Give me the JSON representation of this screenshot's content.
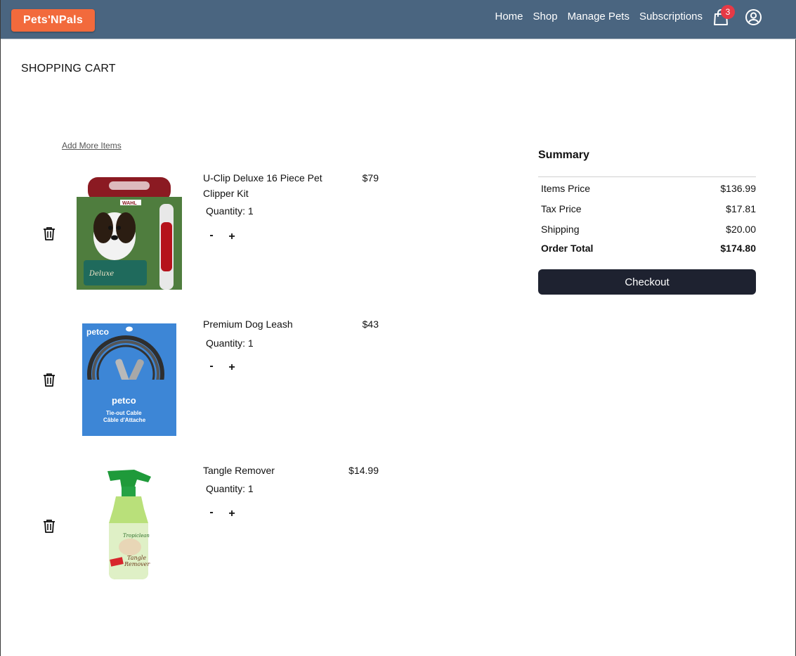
{
  "nav": {
    "logo": "Pets'NPals",
    "links": [
      "Home",
      "Shop",
      "Manage Pets",
      "Subscriptions"
    ],
    "cart_count": "3",
    "cart_icon": "shopping-bag-icon",
    "profile_icon": "user-circle-icon"
  },
  "page": {
    "title": "SHOPPING CART",
    "add_more": "Add More Items"
  },
  "cart": {
    "items": [
      {
        "name": "U-Clip Deluxe 16 Piece Pet Clipper Kit",
        "price": "$79",
        "quantity": "Quantity: 1",
        "minus": "-",
        "plus": "+"
      },
      {
        "name": "Premium Dog Leash",
        "price": "$43",
        "quantity": "Quantity: 1",
        "minus": "-",
        "plus": "+"
      },
      {
        "name": "Tangle Remover",
        "price": "$14.99",
        "quantity": "Quantity: 1",
        "minus": "-",
        "plus": "+"
      }
    ]
  },
  "summary": {
    "title": "Summary",
    "rows": [
      {
        "label": "Items Price",
        "value": "$136.99"
      },
      {
        "label": "Tax Price",
        "value": "$17.81"
      },
      {
        "label": "Shipping",
        "value": "$20.00"
      }
    ],
    "total_label": "Order Total",
    "total_value": "$174.80",
    "checkout": "Checkout"
  },
  "colors": {
    "navbar": "#4a6580",
    "logo": "#f26a3c",
    "badge": "#e63946",
    "checkout": "#1e2230"
  }
}
